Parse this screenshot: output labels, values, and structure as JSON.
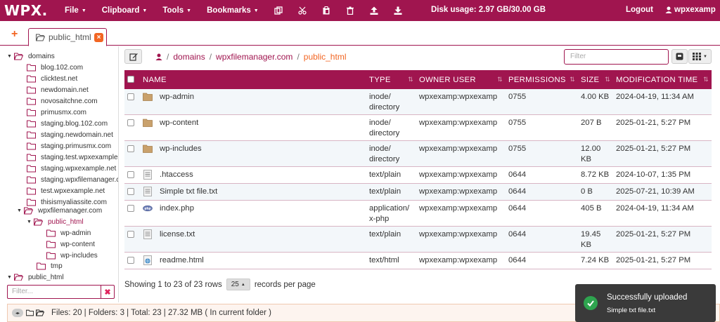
{
  "colors": {
    "brand": "#a0154f",
    "accent": "#f26522",
    "success": "#2ea44f"
  },
  "topbar": {
    "logo": "WPX.",
    "menus": [
      {
        "label": "File"
      },
      {
        "label": "Clipboard"
      },
      {
        "label": "Tools"
      },
      {
        "label": "Bookmarks"
      }
    ],
    "icons": [
      "copy-icon",
      "cut-icon",
      "paste-icon",
      "trash-icon",
      "upload-icon",
      "download-icon"
    ],
    "disk_usage": "Disk usage: 2.97 GB/30.00 GB",
    "logout": "Logout",
    "user": "wpxexamp"
  },
  "tabs": [
    {
      "label": "public_html"
    }
  ],
  "sidebar": {
    "root": "domains",
    "domains": [
      "blog.102.com",
      "clicktest.net",
      "newdomain.net",
      "novosaitchne.com",
      "primusmx.com",
      "staging.blog.102.com",
      "staging.newdomain.net",
      "staging.primusmx.com",
      "staging.test.wpxexample.com",
      "staging.wpxexample.net",
      "staging.wpxfilemanager.com",
      "test.wpxexample.net",
      "thisismyaliassite.com"
    ],
    "expanded": "wpxfilemanager.com",
    "active": "public_html",
    "children": [
      "wp-admin",
      "wp-content",
      "wp-includes"
    ],
    "tmp": "tmp",
    "bottom": "public_html",
    "filter_placeholder": "Filter..."
  },
  "breadcrumb": [
    "domains",
    "wpxfilemanager.com",
    "public_html"
  ],
  "main_filter_placeholder": "Filter",
  "table": {
    "headers": [
      "NAME",
      "TYPE",
      "OWNER USER",
      "PERMISSIONS",
      "SIZE",
      "MODIFICATION TIME"
    ],
    "rows": [
      {
        "icon": "folder",
        "name": "wp-admin",
        "type": "inode/ directory",
        "owner": "wpxexamp:wpxexamp",
        "perm": "0755",
        "size": "4.00 KB",
        "mtime": "2024-04-19, 11:34 AM"
      },
      {
        "icon": "folder",
        "name": "wp-content",
        "type": "inode/ directory",
        "owner": "wpxexamp:wpxexamp",
        "perm": "0755",
        "size": "207 B",
        "mtime": "2025-01-21, 5:27 PM"
      },
      {
        "icon": "folder",
        "name": "wp-includes",
        "type": "inode/ directory",
        "owner": "wpxexamp:wpxexamp",
        "perm": "0755",
        "size": "12.00 KB",
        "mtime": "2025-01-21, 5:27 PM"
      },
      {
        "icon": "text",
        "name": ".htaccess",
        "type": "text/plain",
        "owner": "wpxexamp:wpxexamp",
        "perm": "0644",
        "size": "8.72 KB",
        "mtime": "2024-10-07, 1:35 PM"
      },
      {
        "icon": "text",
        "name": "Simple txt file.txt",
        "type": "text/plain",
        "owner": "wpxexamp:wpxexamp",
        "perm": "0644",
        "size": "0 B",
        "mtime": "2025-07-21, 10:39 AM"
      },
      {
        "icon": "php",
        "name": "index.php",
        "type": "application/ x-php",
        "owner": "wpxexamp:wpxexamp",
        "perm": "0644",
        "size": "405 B",
        "mtime": "2024-04-19, 11:34 AM"
      },
      {
        "icon": "text",
        "name": "license.txt",
        "type": "text/plain",
        "owner": "wpxexamp:wpxexamp",
        "perm": "0644",
        "size": "19.45 KB",
        "mtime": "2025-01-21, 5:27 PM"
      },
      {
        "icon": "html",
        "name": "readme.html",
        "type": "text/html",
        "owner": "wpxexamp:wpxexamp",
        "perm": "0644",
        "size": "7.24 KB",
        "mtime": "2025-01-21, 5:27 PM"
      }
    ]
  },
  "pagination": {
    "showing": "Showing 1 to 23 of 23 rows",
    "per_page_value": "25",
    "per_page_label": "records per page"
  },
  "status": "Files: 20 | Folders: 3 | Total: 23 | 27.32 MB ( In current folder )",
  "toast": {
    "title": "Successfully uploaded",
    "detail": "Simple txt file.txt"
  }
}
